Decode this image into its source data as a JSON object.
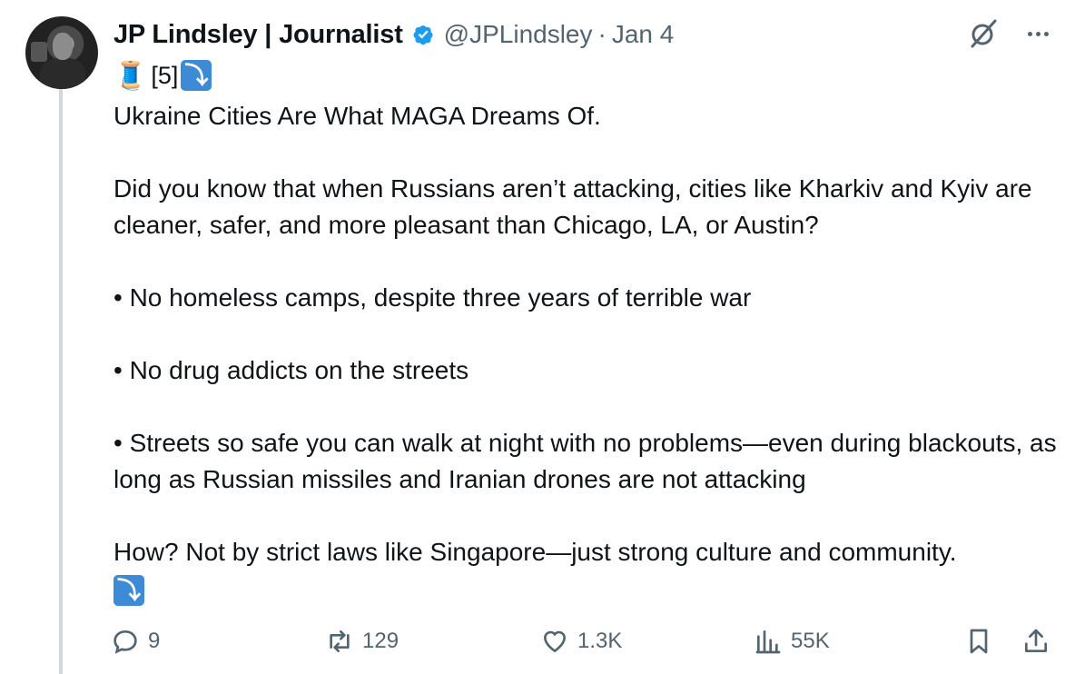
{
  "author": {
    "name": "JP Lindsley | Journalist",
    "handle": "@JPLindsley",
    "separator": "·",
    "date": "Jan 4"
  },
  "tweet": {
    "thread_tag": "[5]",
    "title": "Ukraine Cities Are What MAGA Dreams Of.",
    "para1": "Did you know that when Russians aren’t attacking, cities like Kharkiv and Kyiv are cleaner, safer, and more pleasant than Chicago, LA, or Austin?",
    "bullet1": "• No homeless camps, despite three years of terrible war",
    "bullet2": "• No drug addicts on the streets",
    "bullet3": "• Streets so safe you can walk at night with no problems—even during blackouts, as long as Russian missiles and Iranian drones are not attacking",
    "para2": "How? Not by strict laws like Singapore—just strong culture and community."
  },
  "metrics": {
    "replies": "9",
    "reposts": "129",
    "likes": "1.3K",
    "views": "55K"
  },
  "icons": {
    "reply": "reply-icon",
    "repost": "repost-icon",
    "like": "heart-icon",
    "views": "views-icon",
    "bookmark": "bookmark-icon",
    "share": "share-icon",
    "grok": "grok-icon",
    "more": "more-icon",
    "verified": "verified-badge-icon"
  },
  "colors": {
    "verified": "#1d9bf0",
    "secondary_text": "#536471",
    "emoji_arrow_bg": "#3d8ad6"
  }
}
